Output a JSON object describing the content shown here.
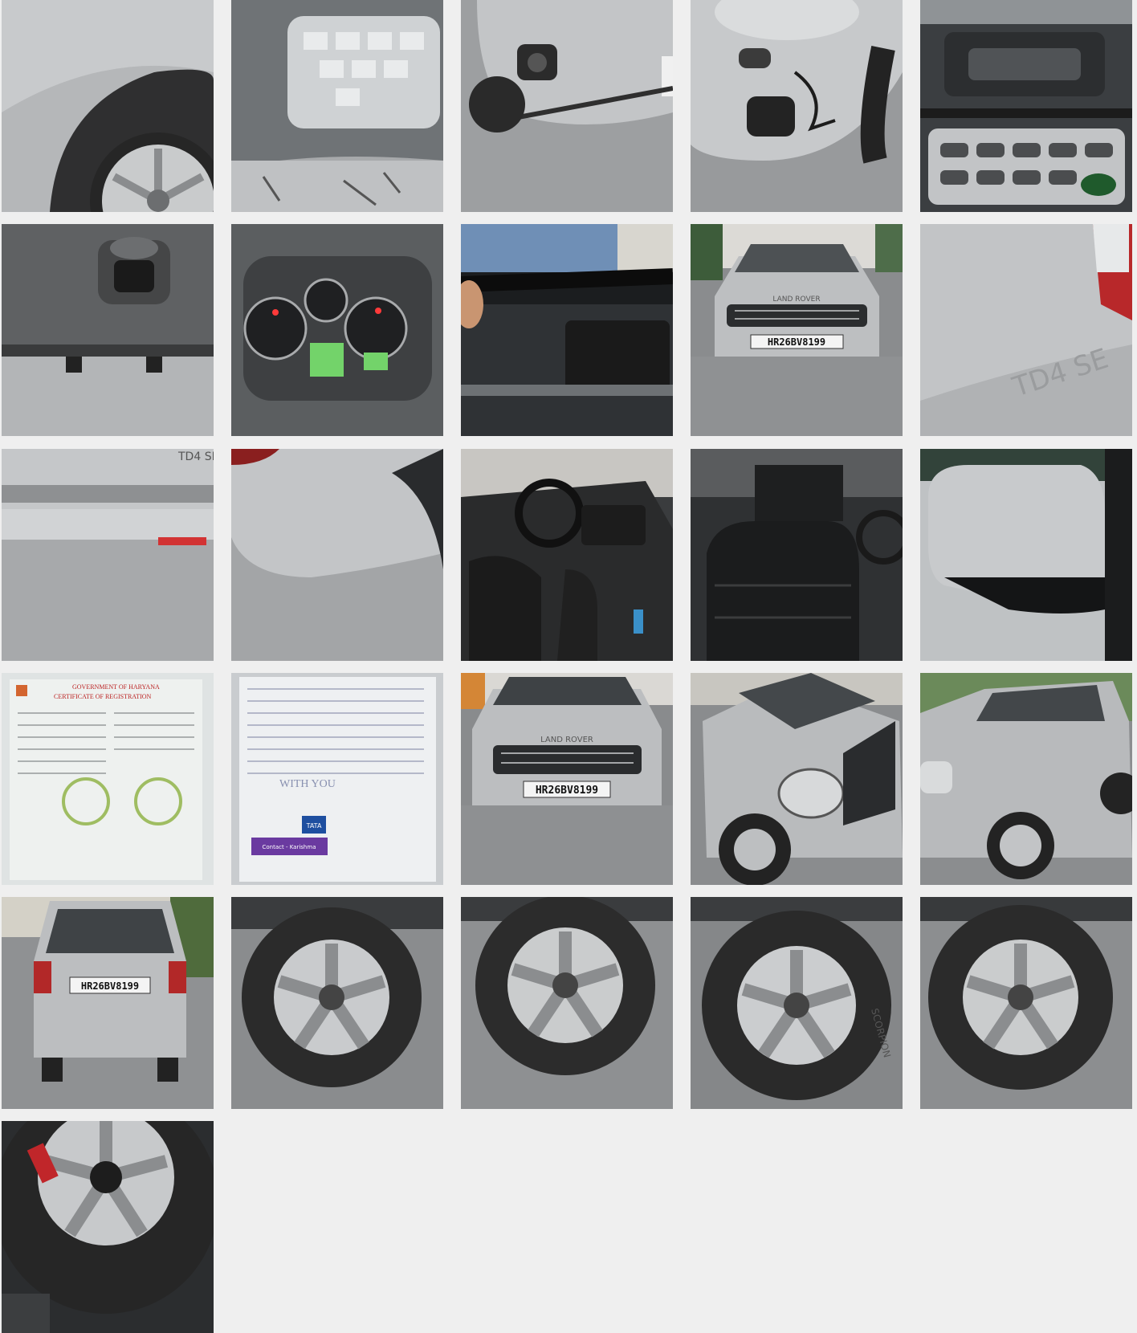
{
  "gallery": {
    "photos": [
      {
        "id": 1,
        "subject": "front-wheel-arch"
      },
      {
        "id": 2,
        "subject": "headlight-closeup"
      },
      {
        "id": 3,
        "subject": "front-bumper-foglamp"
      },
      {
        "id": 4,
        "subject": "damaged-bumper"
      },
      {
        "id": 5,
        "subject": "engine-bay"
      },
      {
        "id": 6,
        "subject": "tow-hook-underside"
      },
      {
        "id": 7,
        "subject": "instrument-cluster"
      },
      {
        "id": 8,
        "subject": "wiper-blade"
      },
      {
        "id": 9,
        "subject": "car-front-view"
      },
      {
        "id": 10,
        "subject": "rear-quarter-panel"
      },
      {
        "id": 11,
        "subject": "rear-bumper"
      },
      {
        "id": 12,
        "subject": "rear-bumper-corner"
      },
      {
        "id": 13,
        "subject": "interior-dashboard"
      },
      {
        "id": 14,
        "subject": "front-seat"
      },
      {
        "id": 15,
        "subject": "side-mirror"
      },
      {
        "id": 16,
        "subject": "registration-certificate"
      },
      {
        "id": 17,
        "subject": "insurance-document"
      },
      {
        "id": 18,
        "subject": "car-front"
      },
      {
        "id": 19,
        "subject": "car-front-angle"
      },
      {
        "id": 20,
        "subject": "car-side-angle"
      },
      {
        "id": 21,
        "subject": "car-rear-view"
      },
      {
        "id": 22,
        "subject": "wheel-1"
      },
      {
        "id": 23,
        "subject": "wheel-2"
      },
      {
        "id": 24,
        "subject": "wheel-3"
      },
      {
        "id": 25,
        "subject": "wheel-4"
      },
      {
        "id": 26,
        "subject": "spare-wheel"
      }
    ]
  },
  "car": {
    "plate": "HR26BV8199",
    "brand_badge": "LAND ROVER",
    "brand_short": "LAND ROVER",
    "model_badge": "TD4 SE",
    "tyre_text": "SCORPION"
  },
  "documents": {
    "rc_title_1": "GOVERNMENT OF HARYANA",
    "rc_title_2": "CERTIFICATE OF REGISTRATION",
    "rc_plate": "HR26BV8199",
    "insurance_brand": "TATA",
    "insurance_slogan": "WITH YOU",
    "insurance_contact": "Contact - Karishma"
  },
  "colors": {
    "background": "#efefef",
    "silver": "#b9bcbf",
    "tyre": "#2b2b2b",
    "asphalt": "#8d8f91",
    "plate_bg": "#f4f4f4"
  }
}
